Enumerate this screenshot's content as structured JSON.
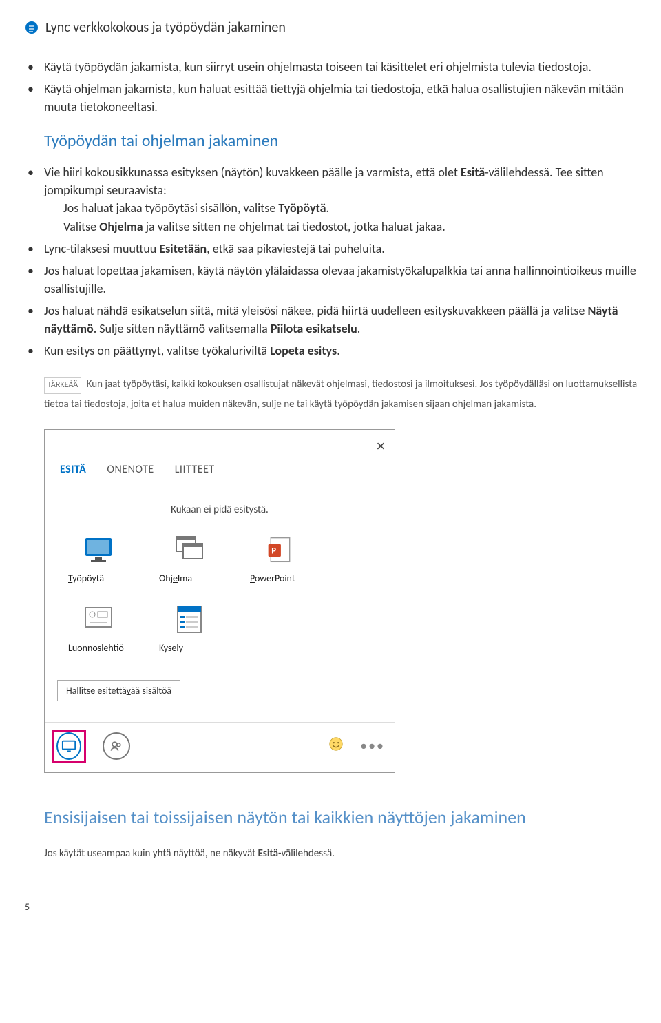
{
  "header": {
    "title": "Lync verkkokokous ja työpöydän jakaminen"
  },
  "intro_bullets": [
    "Käytä työpöydän jakamista, kun siirryt usein ohjelmasta toiseen tai käsittelet eri ohjelmista tulevia tiedostoja.",
    "Käytä ohjelman jakamista, kun haluat esittää tiettyjä ohjelmia tai tiedostoja, etkä halua osallistujien näkevän mitään muuta tietokoneeltasi."
  ],
  "section1_heading": "Työpöydän tai ohjelman jakaminen",
  "section1_bullets": {
    "b1_pre": "Vie hiiri kokousikkunassa esityksen (näytön) kuvakkeen päälle ja varmista, että olet ",
    "b1_bold": "Esitä",
    "b1_post": "-välilehdessä. Tee sitten jompikumpi seuraavista:",
    "b1_sub1_pre": "Jos haluat jakaa työpöytäsi sisällön, valitse ",
    "b1_sub1_bold": "Työpöytä",
    "b1_sub1_post": ".",
    "b1_sub2_pre": "Valitse ",
    "b1_sub2_bold": "Ohjelma",
    "b1_sub2_post": " ja valitse sitten ne ohjelmat tai tiedostot, jotka haluat jakaa.",
    "b2_pre": "Lync-tilaksesi muuttuu ",
    "b2_bold": "Esitetään",
    "b2_post": ", etkä saa pikaviestejä tai puheluita.",
    "b3": "Jos haluat lopettaa jakamisen, käytä näytön ylälaidassa olevaa jakamistyökalupalkkia tai anna hallinnointioikeus muille osallistujille.",
    "b4_pre": "Jos haluat nähdä esikatselun siitä, mitä yleisösi näkee, pidä hiirtä uudelleen esityskuvakkeen päällä ja valitse ",
    "b4_bold1": "Näytä näyttämö",
    "b4_mid": ". Sulje sitten näyttämö valitsemalla ",
    "b4_bold2": "Piilota esikatselu",
    "b4_post": ".",
    "b5_pre": "Kun esitys on päättynyt, valitse työkaluriviltä ",
    "b5_bold": "Lopeta esitys",
    "b5_post": "."
  },
  "note": {
    "label": "TÄRKEÄÄ",
    "text": "Kun jaat työpöytäsi, kaikki kokouksen osallistujat näkevät ohjelmasi, tiedostosi ja ilmoituksesi. Jos työpöydälläsi on luottamuksellista tietoa tai tiedostoja, joita et halua muiden näkevän, sulje ne tai käytä työpöydän jakamisen sijaan ohjelman jakamista."
  },
  "panel": {
    "tabs": {
      "esita": "ESITÄ",
      "onenote": "ONENOTE",
      "liitteet": "LIITTEET"
    },
    "status": "Kukaan ei pidä esitystä.",
    "tiles": {
      "tyopoyta": "Työpöytä",
      "ohjelma": "Ohjelma",
      "powerpoint": "PowerPoint",
      "luonnoslehtio": "Luonnoslehtiö",
      "kysely": "Kysely"
    },
    "manage": "Hallitse esitettävää sisältöä"
  },
  "section2_heading": "Ensisijaisen tai toissijaisen näytön tai kaikkien näyttöjen jakaminen",
  "section2_note_pre": "Jos käytät useampaa kuin yhtä näyttöä, ne näkyvät ",
  "section2_note_bold": "Esitä",
  "section2_note_post": "-välilehdessä.",
  "page_number": "5"
}
